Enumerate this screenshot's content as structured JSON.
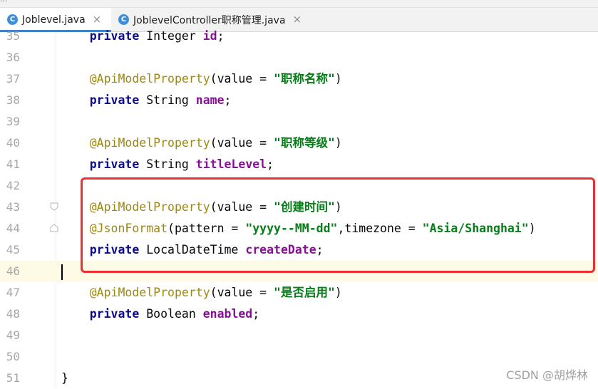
{
  "top_strip": {
    "text": "..."
  },
  "tabs": [
    {
      "label": "Joblevel.java",
      "icon": "class-icon",
      "active": true
    },
    {
      "label": "JoblevelController职称管理.java",
      "icon": "class-icon",
      "active": false
    }
  ],
  "tab_close_symbol": "×",
  "file_icon_letter": "C",
  "editor": {
    "current_line": "46",
    "lines": [
      {
        "n": "35",
        "tokens": [
          [
            "kw",
            "private"
          ],
          [
            "pl",
            " Integer "
          ],
          [
            "fld",
            "id"
          ],
          [
            "pl",
            ";"
          ]
        ]
      },
      {
        "n": "36",
        "tokens": []
      },
      {
        "n": "37",
        "tokens": [
          [
            "ann",
            "@ApiModelProperty"
          ],
          [
            "pl",
            "(value = "
          ],
          [
            "str",
            "\"职称名称\""
          ],
          [
            "pl",
            ")"
          ]
        ]
      },
      {
        "n": "38",
        "tokens": [
          [
            "kw",
            "private"
          ],
          [
            "pl",
            " String "
          ],
          [
            "fld",
            "name"
          ],
          [
            "pl",
            ";"
          ]
        ]
      },
      {
        "n": "39",
        "tokens": []
      },
      {
        "n": "40",
        "tokens": [
          [
            "ann",
            "@ApiModelProperty"
          ],
          [
            "pl",
            "(value = "
          ],
          [
            "str",
            "\"职称等级\""
          ],
          [
            "pl",
            ")"
          ]
        ]
      },
      {
        "n": "41",
        "tokens": [
          [
            "kw",
            "private"
          ],
          [
            "pl",
            " String "
          ],
          [
            "fld",
            "titleLevel"
          ],
          [
            "pl",
            ";"
          ]
        ]
      },
      {
        "n": "42",
        "tokens": []
      },
      {
        "n": "43",
        "tokens": [
          [
            "ann",
            "@ApiModelProperty"
          ],
          [
            "pl",
            "(value = "
          ],
          [
            "str",
            "\"创建时间\""
          ],
          [
            "pl",
            ")"
          ]
        ]
      },
      {
        "n": "44",
        "tokens": [
          [
            "ann",
            "@JsonFormat"
          ],
          [
            "pl",
            "(pattern = "
          ],
          [
            "str",
            "\"yyyy--MM-dd\""
          ],
          [
            "pl",
            ",timezone = "
          ],
          [
            "str",
            "\"Asia/Shanghai\""
          ],
          [
            "pl",
            ")"
          ]
        ]
      },
      {
        "n": "45",
        "tokens": [
          [
            "kw",
            "private"
          ],
          [
            "pl",
            " LocalDateTime "
          ],
          [
            "fld",
            "createDate"
          ],
          [
            "pl",
            ";"
          ]
        ]
      },
      {
        "n": "46",
        "tokens": []
      },
      {
        "n": "47",
        "tokens": [
          [
            "ann",
            "@ApiModelProperty"
          ],
          [
            "pl",
            "(value = "
          ],
          [
            "str",
            "\"是否启用\""
          ],
          [
            "pl",
            ")"
          ]
        ]
      },
      {
        "n": "48",
        "tokens": [
          [
            "kw",
            "private"
          ],
          [
            "pl",
            " Boolean "
          ],
          [
            "fld",
            "enabled"
          ],
          [
            "pl",
            ";"
          ]
        ]
      },
      {
        "n": "49",
        "tokens": []
      },
      {
        "n": "50",
        "tokens": []
      },
      {
        "n": "51",
        "tokens": [
          [
            "pl",
            "}"
          ]
        ]
      }
    ]
  },
  "watermark": "CSDN @胡烨林",
  "colors": {
    "keyword": "#0a0a8c",
    "annotation": "#9e880d",
    "string": "#067d17",
    "field": "#871094",
    "highlight_border": "#ef2f2f",
    "tab_underline": "#4083c9"
  }
}
